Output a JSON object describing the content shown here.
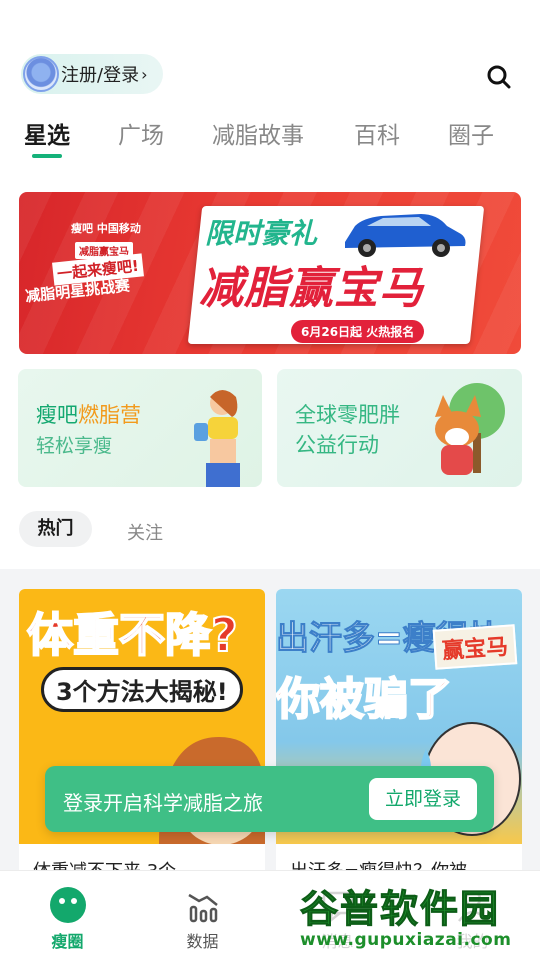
{
  "header": {
    "login_label": "注册/登录",
    "login_chevron": "›",
    "search_icon": "search-icon"
  },
  "tabs": [
    {
      "label": "星选",
      "active": true
    },
    {
      "label": "广场",
      "active": false
    },
    {
      "label": "减脂故事",
      "active": false
    },
    {
      "label": "百科",
      "active": false
    },
    {
      "label": "圈子",
      "active": false
    }
  ],
  "banner": {
    "left_logos": "瘦吧  中国移动",
    "left_tag": "减脂赢宝马",
    "left_line1": "一起来瘦吧!",
    "left_line2": "减脂明星挑战赛",
    "title1": "限时豪礼",
    "title2": "减脂赢宝马",
    "date_badge": "6月26日起  火热报名"
  },
  "promos": {
    "left": {
      "title_main": "瘦吧",
      "title_accent": "燃脂营",
      "subtitle": "轻松享瘦"
    },
    "right": {
      "title": "全球零肥胖",
      "subtitle": "公益行动"
    }
  },
  "feed_filter": {
    "hot_label": "热门",
    "follow_label": "关注"
  },
  "feed": [
    {
      "cover_big": "体重不降?",
      "cover_pill": "3个方法大揭秘!",
      "title": "体重减不下来 3个"
    },
    {
      "cover_line1": "出汗多=瘦得快",
      "cover_line2": "你被骗了",
      "cover_badge": "赢宝马",
      "title": "出汗多=瘦得快？你被"
    }
  ],
  "toast": {
    "text": "登录开启科学减脂之旅",
    "button_label": "立即登录"
  },
  "bottom_nav": [
    {
      "label": "瘦圈",
      "icon": "planet-icon",
      "active": true
    },
    {
      "label": "数据",
      "icon": "bar-chart-icon",
      "active": false
    },
    {
      "label": "消息",
      "icon": "message-icon",
      "active": false
    },
    {
      "label": "我的",
      "icon": "profile-icon",
      "active": false
    }
  ],
  "watermark": {
    "title": "谷普软件园",
    "url": "www.gupuxiazai.com"
  },
  "colors": {
    "brand_green": "#13a86c",
    "tab_indicator": "#15b27a",
    "toast_bg": "#3fbf86",
    "banner_red": "#e2213a"
  }
}
